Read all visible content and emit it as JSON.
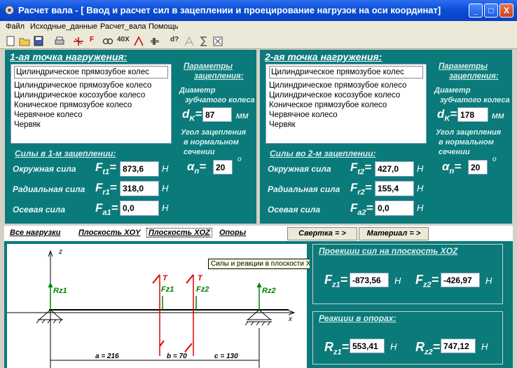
{
  "window": {
    "title": "Расчет вала - [ Ввод и расчет сил в зацеплении и проецирование нагрузок на оси координат]",
    "controls": {
      "minimize": "_",
      "maximize": "□",
      "close": "X"
    }
  },
  "menu": [
    "Файл",
    "Исходные_данные",
    "Расчет_вала",
    "Помощь"
  ],
  "toolbar": {
    "buttons": [
      "open",
      "save",
      "print",
      "forces",
      "F",
      "link",
      "40X",
      "angle",
      "sigma",
      "d?",
      "crane",
      "sum",
      "exit"
    ],
    "labels": {
      "f": "F",
      "x40": "40X",
      "d": "d?"
    }
  },
  "point1": {
    "header": "1-ая точка нагружения:",
    "gear_selected": "Цилиндрическое прямозубое колес",
    "gear_options": [
      "Цилиндрическое прямозубое колесо",
      "Цилиндрическое косозубое колесо",
      "Коническое прямозубое колесо",
      "Червячное колесо",
      "Червяк"
    ],
    "params_header": "Параметры зацепления:",
    "params_header_1": "Параметры",
    "params_header_2": "зацепления:",
    "diameter_label_1": "Диаметр",
    "diameter_label_2": "зубчатого колеса",
    "diameter_symbol": "d",
    "diameter_sub": "K",
    "diameter_value": "87",
    "diameter_unit": "мм",
    "angle_label_1": "Угол зацепления",
    "angle_label_2": "в нормальном",
    "angle_label_3": "сечении",
    "angle_symbol": "α",
    "angle_sub": "n",
    "angle_value": "20",
    "angle_unit": "o",
    "forces_header": "Силы в 1-м зацеплении:",
    "forces": [
      {
        "label": "Окружная сила",
        "symbol": "F",
        "sub": "t1",
        "value": "873,6",
        "unit": "H"
      },
      {
        "label": "Радиальная сила",
        "symbol": "F",
        "sub": "r1",
        "value": "318,0",
        "unit": "H"
      },
      {
        "label": "Осевая сила",
        "symbol": "F",
        "sub": "a1",
        "value": "0,0",
        "unit": "H"
      }
    ]
  },
  "point2": {
    "header": "2-ая точка нагружения:",
    "gear_selected": "Цилиндрическое прямозубое колес",
    "gear_options": [
      "Цилиндрическое прямозубое колесо",
      "Цилиндрическое косозубое колесо",
      "Коническое прямозубое колесо",
      "Червячное колесо",
      "Червяк"
    ],
    "params_header_1": "Параметры",
    "params_header_2": "зацепления:",
    "diameter_label_1": "Диаметр",
    "diameter_label_2": "зубчатого колеса",
    "diameter_symbol": "d",
    "diameter_sub": "K",
    "diameter_value": "178",
    "diameter_unit": "мм",
    "angle_label_1": "Угол зацепления",
    "angle_label_2": "в нормальном",
    "angle_label_3": "сечении",
    "angle_symbol": "α",
    "angle_sub": "n",
    "angle_value": "20",
    "angle_unit": "o",
    "forces_header": "Силы во 2-м зацеплении:",
    "forces": [
      {
        "label": "Окружная сила",
        "symbol": "F",
        "sub": "t2",
        "value": "427,0",
        "unit": "H"
      },
      {
        "label": "Радиальная сила",
        "symbol": "F",
        "sub": "r2",
        "value": "155,4",
        "unit": "H"
      },
      {
        "label": "Осевая сила",
        "symbol": "F",
        "sub": "a2",
        "value": "0,0",
        "unit": "H"
      }
    ]
  },
  "tabs": {
    "all_loads": "Все нагрузки",
    "plane_xoy": "Плоскость XOY",
    "plane_xoz": "Плоскость XOZ",
    "supports": "Опоры",
    "fold_button": "Свертка = >",
    "material_button": "Материал = >"
  },
  "tooltip": "Силы и реакции в плоскости XOZ",
  "diagram": {
    "z_axis": "z",
    "x_axis": "x",
    "rz1": "Rz1",
    "rz2": "Rz2",
    "fz1": "Fz1",
    "fz2": "Fz2",
    "t1": "T",
    "t2": "T",
    "dim_a": "a = 216",
    "dim_b": "b = 70",
    "dim_c": "c = 130"
  },
  "projections": {
    "header": "Проекции сил на плоскость XOZ",
    "items": [
      {
        "symbol": "F",
        "sub": "z1",
        "value": "-873,56",
        "unit": "H"
      },
      {
        "symbol": "F",
        "sub": "z2",
        "value": "-426,97",
        "unit": "H"
      }
    ]
  },
  "reactions": {
    "header": "Реакции в опорах:",
    "items": [
      {
        "symbol": "R",
        "sub": "z1",
        "value": "553,41",
        "unit": "H"
      },
      {
        "symbol": "R",
        "sub": "z2",
        "value": "747,12",
        "unit": "H"
      }
    ]
  },
  "colors": {
    "teal": "#0b7a7a",
    "title_blue": "#0a4fd6",
    "force_red": "#e00000",
    "label_green": "#008000"
  }
}
